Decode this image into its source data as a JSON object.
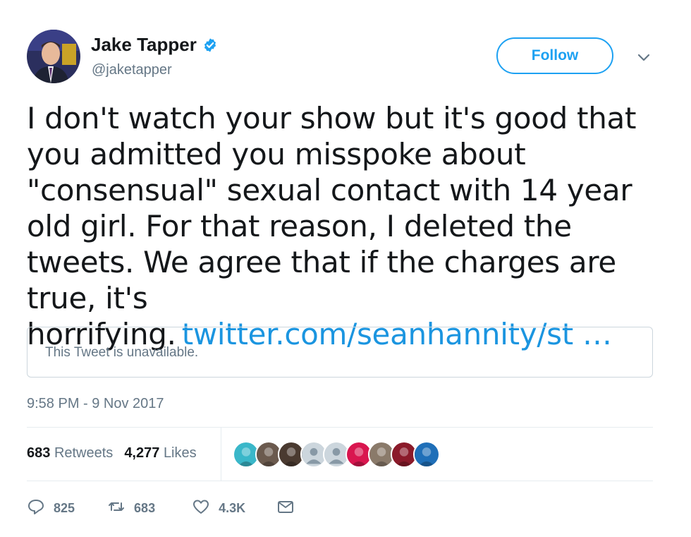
{
  "header": {
    "display_name": "Jake Tapper",
    "handle": "@jaketapper",
    "follow_label": "Follow"
  },
  "tweet": {
    "text": "I don't watch your show but it's good that you admitted you misspoke about \"consensual\" sexual contact with 14 year old girl. For that reason, I deleted the tweets. We agree that if the charges are true, it's horrifying.",
    "link": "twitter.com/seanhannity/st …"
  },
  "quote": {
    "text": "This Tweet is unavailable."
  },
  "timestamp": "9:58 PM - 9 Nov 2017",
  "stats": {
    "retweets_count": "683",
    "retweets_label": "Retweets",
    "likes_count": "4,277",
    "likes_label": "Likes"
  },
  "likers": [
    "#3ab7c9",
    "#6b5a4e",
    "#4a3a30",
    "#aab8c2",
    "#aab8c2",
    "#d9164f",
    "#8a7a6a",
    "#8b1a2a",
    "#1f6fb8"
  ],
  "actions": {
    "reply_count": "825",
    "retweet_count": "683",
    "like_count": "4.3K"
  },
  "colors": {
    "accent": "#1da1f2",
    "link": "#1b95e0",
    "secondary_text": "#657786"
  }
}
